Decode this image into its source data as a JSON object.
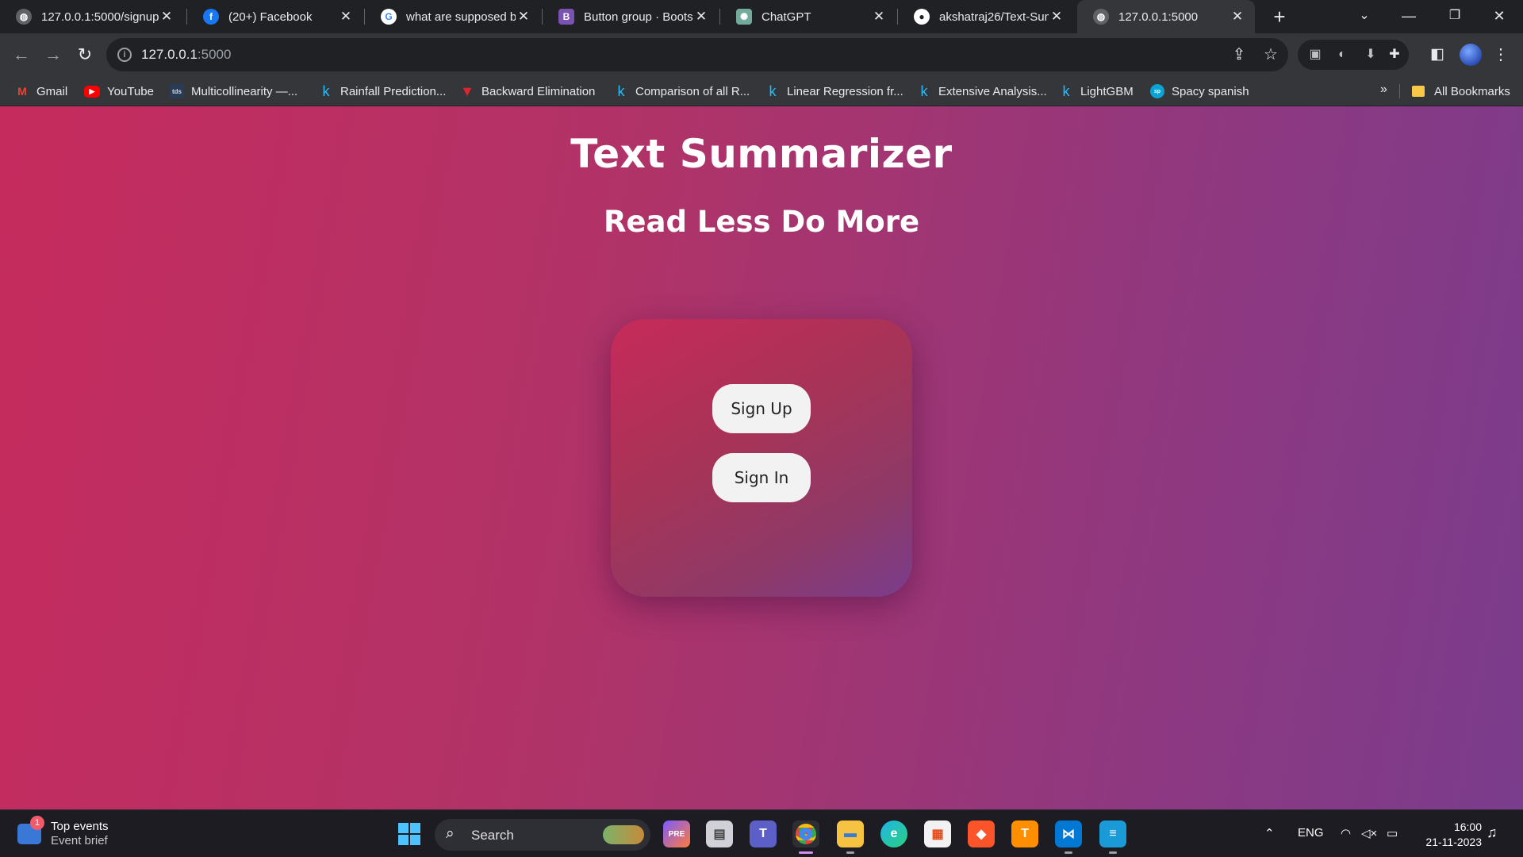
{
  "browser": {
    "tabs": [
      {
        "title": "127.0.0.1:5000/signup",
        "icon": "globe-icon",
        "active": false
      },
      {
        "title": "(20+) Facebook",
        "icon": "facebook-icon",
        "active": false
      },
      {
        "title": "what are supposed b",
        "icon": "google-icon",
        "active": false
      },
      {
        "title": "Button group · Boots",
        "icon": "bootstrap-icon",
        "active": false
      },
      {
        "title": "ChatGPT",
        "icon": "chatgpt-icon",
        "active": false
      },
      {
        "title": "akshatraj26/Text-Sum",
        "icon": "github-icon",
        "active": false
      },
      {
        "title": "127.0.0.1:5000",
        "icon": "globe-icon",
        "active": true
      }
    ],
    "address": {
      "host": "127.0.0.1",
      "port": ":5000"
    },
    "bookmarks": [
      {
        "label": "Gmail",
        "icon": "gmail-icon"
      },
      {
        "label": "YouTube",
        "icon": "youtube-icon"
      },
      {
        "label": "Multicollinearity —...",
        "icon": "tds-icon",
        "icon_text": "tds"
      },
      {
        "label": "Rainfall Prediction...",
        "icon": "kaggle-icon",
        "icon_text": "k"
      },
      {
        "label": "Backward Elimination",
        "icon": "triangle-logo-icon"
      },
      {
        "label": "Comparison of all R...",
        "icon": "kaggle-icon",
        "icon_text": "k"
      },
      {
        "label": "Linear Regression fr...",
        "icon": "kaggle-icon",
        "icon_text": "k"
      },
      {
        "label": "Extensive Analysis...",
        "icon": "kaggle-icon",
        "icon_text": "k"
      },
      {
        "label": "LightGBM",
        "icon": "kaggle-icon",
        "icon_text": "k"
      },
      {
        "label": "Spacy spanish",
        "icon": "spacy-icon"
      }
    ],
    "bookmarks_more": "»",
    "all_bookmarks": "All Bookmarks"
  },
  "page": {
    "title": "Text Summarizer",
    "subtitle": "Read Less Do More",
    "signup_label": "Sign Up",
    "signin_label": "Sign In"
  },
  "taskbar": {
    "widget_title": "Top events",
    "widget_subtitle": "Event brief",
    "widget_badge": "1",
    "search_label": "Search",
    "language": "ENG",
    "time": "16:00",
    "date": "21-11-2023"
  },
  "colors": {
    "page_gradient_start": "#c62b5d",
    "page_gradient_end": "#7a3c8c",
    "button_bg": "#f2f2f2"
  }
}
